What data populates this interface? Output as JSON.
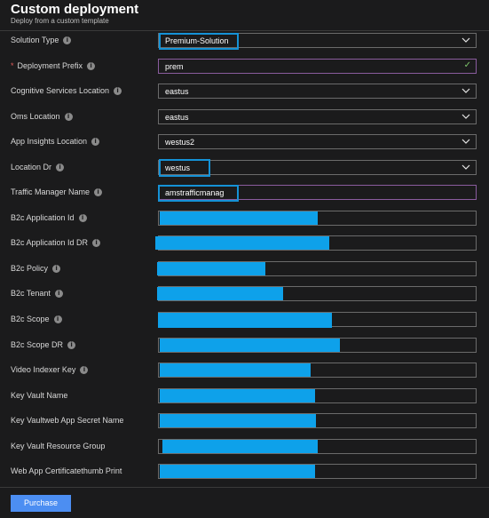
{
  "header": {
    "title": "Custom deployment",
    "subtitle": "Deploy from a custom template"
  },
  "fields": {
    "solution_type": {
      "label": "Solution Type",
      "value": "Premium-Solution"
    },
    "deployment_prefix": {
      "label": "Deployment Prefix",
      "required_marker": "*",
      "value": "prem"
    },
    "cognitive_services_location": {
      "label": "Cognitive Services Location",
      "value": "eastus"
    },
    "oms_location": {
      "label": "Oms Location",
      "value": "eastus"
    },
    "app_insights_location": {
      "label": "App Insights Location",
      "value": "westus2"
    },
    "location_dr": {
      "label": "Location Dr",
      "value": "westus"
    },
    "traffic_manager_name": {
      "label": "Traffic Manager Name",
      "value": "amstrafficmanag"
    },
    "b2c_application_id": {
      "label": "B2c Application Id"
    },
    "b2c_application_id_dr": {
      "label": "B2c Application Id DR"
    },
    "b2c_policy": {
      "label": "B2c Policy"
    },
    "b2c_tenant": {
      "label": "B2c Tenant"
    },
    "b2c_scope": {
      "label": "B2c Scope"
    },
    "b2c_scope_dr": {
      "label": "B2c Scope DR"
    },
    "video_indexer_key": {
      "label": "Video Indexer Key"
    },
    "key_vault_name": {
      "label": "Key Vault Name"
    },
    "key_vaultweb_app_secret_name": {
      "label": "Key Vaultweb App Secret Name"
    },
    "key_vault_resource_group": {
      "label": "Key Vault Resource Group"
    },
    "web_app_certificatethumb_print": {
      "label": "Web App Certificatethumb Print"
    }
  },
  "icons": {
    "info": "info-icon",
    "dropdown": "chevron-down-icon",
    "valid": "checkmark-icon"
  },
  "info_glyph": "i",
  "check_glyph": "✓",
  "colors": {
    "background": "#1b1b1c",
    "purple_border": "#8a5c9e",
    "highlight": "#1592d6",
    "redaction": "#0ea1ea",
    "button": "#4c8ef2",
    "valid": "#7ec66b",
    "required": "#e05a5a"
  },
  "footer": {
    "purchase_label": "Purchase"
  }
}
